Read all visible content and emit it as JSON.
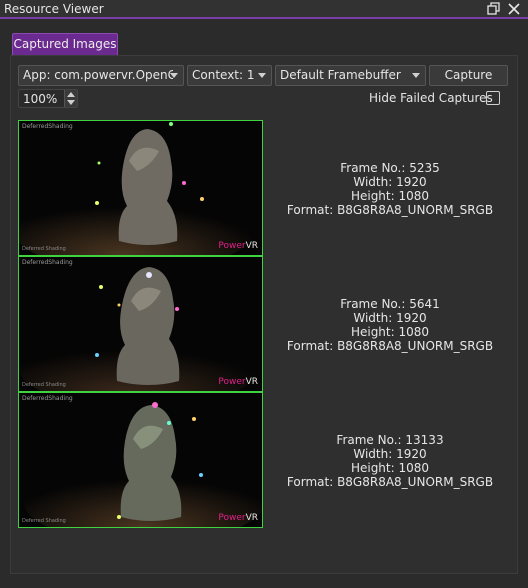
{
  "window": {
    "title": "Resource Viewer"
  },
  "tabs": [
    {
      "label": "Captured Images",
      "active": true
    }
  ],
  "toolbar": {
    "app_select": "App: com.powervr.OpenG",
    "context_select": "Context: 1",
    "framebuffer_select": "Default Framebuffer",
    "capture_label": "Capture",
    "zoom_value": "100%",
    "hide_failed_label": "Hide Failed Captures",
    "hide_failed_checked": false
  },
  "captures": [
    {
      "overlay_title": "DeferredShading",
      "overlay_small": "Deferred Shading",
      "logo_a": "Power",
      "logo_b": "VR",
      "frame": "Frame No.: 5235",
      "width": "Width: 1920",
      "height": "Height: 1080",
      "format": "Format: B8G8R8A8_UNORM_SRGB"
    },
    {
      "overlay_title": "DeferredShading",
      "overlay_small": "Deferred Shading",
      "logo_a": "Power",
      "logo_b": "VR",
      "frame": "Frame No.: 5641",
      "width": "Width: 1920",
      "height": "Height: 1080",
      "format": "Format: B8G8R8A8_UNORM_SRGB"
    },
    {
      "overlay_title": "DeferredShading",
      "overlay_small": "Deferred Shading",
      "logo_a": "Power",
      "logo_b": "VR",
      "frame": "Frame No.: 13133",
      "width": "Width: 1920",
      "height": "Height: 1080",
      "format": "Format: B8G8R8A8_UNORM_SRGB"
    }
  ],
  "colors": {
    "accent": "#7a3ea6",
    "tab_active": "#6b2a8f",
    "thumb_border": "#3fd43f",
    "background": "#2b2b2b"
  }
}
